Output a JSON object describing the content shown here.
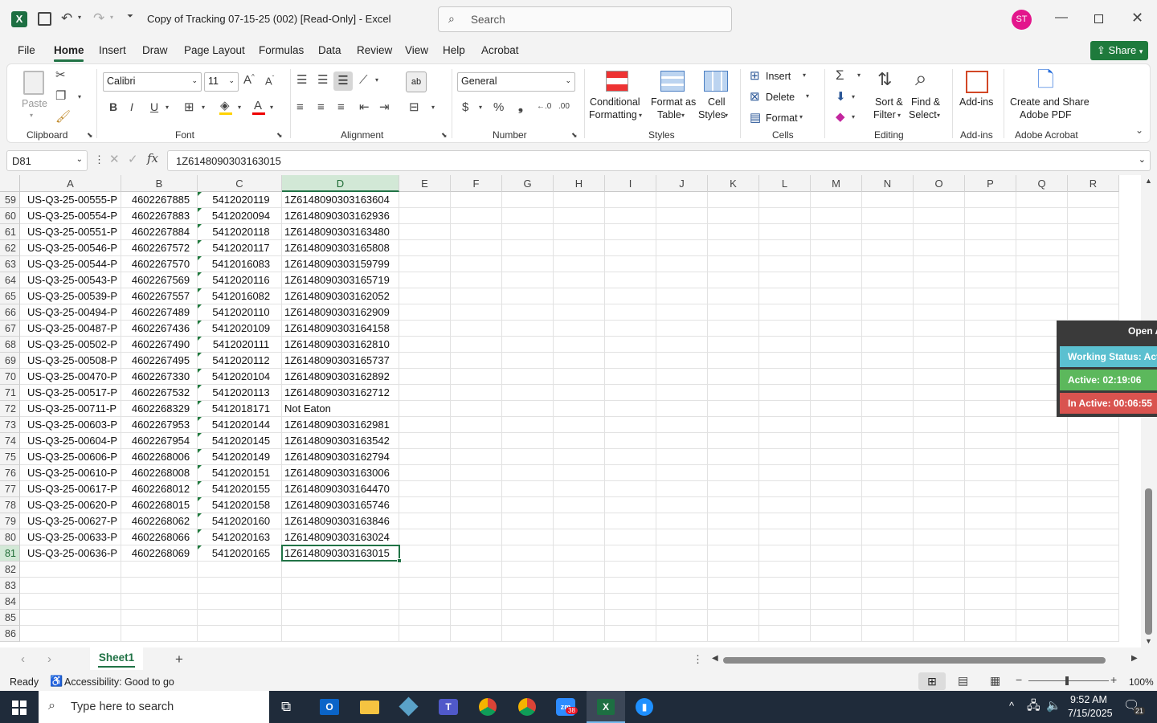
{
  "title": {
    "doc": "Copy of Tracking 07-15-25 (002) [Read-Only]  -  Excel",
    "search_placeholder": "Search",
    "user_initials": "ST"
  },
  "menu": [
    "File",
    "Home",
    "Insert",
    "Draw",
    "Page Layout",
    "Formulas",
    "Data",
    "Review",
    "View",
    "Help",
    "Acrobat"
  ],
  "share": "Share",
  "ribbon": {
    "clipboard": {
      "label": "Clipboard",
      "paste": "Paste"
    },
    "font": {
      "label": "Font",
      "name": "Calibri",
      "size": "11"
    },
    "alignment": {
      "label": "Alignment"
    },
    "number": {
      "label": "Number",
      "format": "General"
    },
    "styles": {
      "label": "Styles",
      "cond1": "Conditional",
      "cond2": "Formatting",
      "fmt1": "Format as",
      "fmt2": "Table",
      "cell1": "Cell",
      "cell2": "Styles"
    },
    "cells": {
      "label": "Cells",
      "insert": "Insert",
      "delete": "Delete",
      "format": "Format"
    },
    "editing": {
      "label": "Editing",
      "sort1": "Sort &",
      "sort2": "Filter",
      "find1": "Find &",
      "find2": "Select"
    },
    "addins": {
      "label": "Add-ins",
      "btn": "Add-ins"
    },
    "acrobat": {
      "label": "Adobe Acrobat",
      "btn1": "Create and Share",
      "btn2": "Adobe PDF"
    }
  },
  "formula": {
    "namebox": "D81",
    "value": "1Z6148090303163015"
  },
  "columns": [
    "A",
    "B",
    "C",
    "D",
    "E",
    "F",
    "G",
    "H",
    "I",
    "J",
    "K",
    "L",
    "M",
    "N",
    "O",
    "P",
    "Q",
    "R"
  ],
  "rows": [
    {
      "n": "59",
      "a": "US-Q3-25-00555-P",
      "b": "4602267885",
      "c": "5412020119",
      "d": "1Z6148090303163604"
    },
    {
      "n": "60",
      "a": "US-Q3-25-00554-P",
      "b": "4602267883",
      "c": "5412020094",
      "d": "1Z6148090303162936"
    },
    {
      "n": "61",
      "a": "US-Q3-25-00551-P",
      "b": "4602267884",
      "c": "5412020118",
      "d": "1Z6148090303163480"
    },
    {
      "n": "62",
      "a": "US-Q3-25-00546-P",
      "b": "4602267572",
      "c": "5412020117",
      "d": "1Z6148090303165808"
    },
    {
      "n": "63",
      "a": "US-Q3-25-00544-P",
      "b": "4602267570",
      "c": "5412016083",
      "d": "1Z6148090303159799"
    },
    {
      "n": "64",
      "a": "US-Q3-25-00543-P",
      "b": "4602267569",
      "c": "5412020116",
      "d": "1Z6148090303165719"
    },
    {
      "n": "65",
      "a": "US-Q3-25-00539-P",
      "b": "4602267557",
      "c": "5412016082",
      "d": "1Z6148090303162052"
    },
    {
      "n": "66",
      "a": "US-Q3-25-00494-P",
      "b": "4602267489",
      "c": "5412020110",
      "d": "1Z6148090303162909"
    },
    {
      "n": "67",
      "a": "US-Q3-25-00487-P",
      "b": "4602267436",
      "c": "5412020109",
      "d": "1Z6148090303164158"
    },
    {
      "n": "68",
      "a": "US-Q3-25-00502-P",
      "b": "4602267490",
      "c": "5412020111",
      "d": "1Z6148090303162810"
    },
    {
      "n": "69",
      "a": "US-Q3-25-00508-P",
      "b": "4602267495",
      "c": "5412020112",
      "d": "1Z6148090303165737"
    },
    {
      "n": "70",
      "a": "US-Q3-25-00470-P",
      "b": "4602267330",
      "c": "5412020104",
      "d": "1Z6148090303162892"
    },
    {
      "n": "71",
      "a": "US-Q3-25-00517-P",
      "b": "4602267532",
      "c": "5412020113",
      "d": "1Z6148090303162712"
    },
    {
      "n": "72",
      "a": "US-Q3-25-00711-P",
      "b": "4602268329",
      "c": "5412018171",
      "d": "Not Eaton"
    },
    {
      "n": "73",
      "a": "US-Q3-25-00603-P",
      "b": "4602267953",
      "c": "5412020144",
      "d": "1Z6148090303162981"
    },
    {
      "n": "74",
      "a": "US-Q3-25-00604-P",
      "b": "4602267954",
      "c": "5412020145",
      "d": "1Z6148090303163542"
    },
    {
      "n": "75",
      "a": "US-Q3-25-00606-P",
      "b": "4602268006",
      "c": "5412020149",
      "d": "1Z6148090303162794"
    },
    {
      "n": "76",
      "a": "US-Q3-25-00610-P",
      "b": "4602268008",
      "c": "5412020151",
      "d": "1Z6148090303163006"
    },
    {
      "n": "77",
      "a": "US-Q3-25-00617-P",
      "b": "4602268012",
      "c": "5412020155",
      "d": "1Z6148090303164470"
    },
    {
      "n": "78",
      "a": "US-Q3-25-00620-P",
      "b": "4602268015",
      "c": "5412020158",
      "d": "1Z6148090303165746"
    },
    {
      "n": "79",
      "a": "US-Q3-25-00627-P",
      "b": "4602268062",
      "c": "5412020160",
      "d": "1Z6148090303163846"
    },
    {
      "n": "80",
      "a": "US-Q3-25-00633-P",
      "b": "4602268066",
      "c": "5412020163",
      "d": "1Z6148090303163024"
    },
    {
      "n": "81",
      "a": "US-Q3-25-00636-P",
      "b": "4602268069",
      "c": "5412020165",
      "d": "1Z6148090303163015"
    },
    {
      "n": "82",
      "a": "",
      "b": "",
      "c": "",
      "d": ""
    },
    {
      "n": "83",
      "a": "",
      "b": "",
      "c": "",
      "d": ""
    },
    {
      "n": "84",
      "a": "",
      "b": "",
      "c": "",
      "d": ""
    },
    {
      "n": "85",
      "a": "",
      "b": "",
      "c": "",
      "d": ""
    },
    {
      "n": "86",
      "a": "",
      "b": "",
      "c": "",
      "d": ""
    }
  ],
  "overlay": {
    "open": "Open A",
    "working": "Working Status: Act",
    "active": "Active: 02:19:06",
    "inactive": "In Active: 00:06:55",
    "colors": {
      "working": "#5bc0d0",
      "active": "#5cb85c",
      "inactive": "#d9534f"
    }
  },
  "sheet": {
    "name": "Sheet1"
  },
  "status": {
    "ready": "Ready",
    "accessibility": "Accessibility: Good to go",
    "zoom": "100%"
  },
  "taskbar": {
    "search": "Type here to search",
    "time": "9:52 AM",
    "date": "7/15/2025",
    "zoom_badge": "38",
    "notif": "21"
  },
  "colors": {
    "excel_green": "#217346",
    "share_bg": "#1e7a3c"
  }
}
